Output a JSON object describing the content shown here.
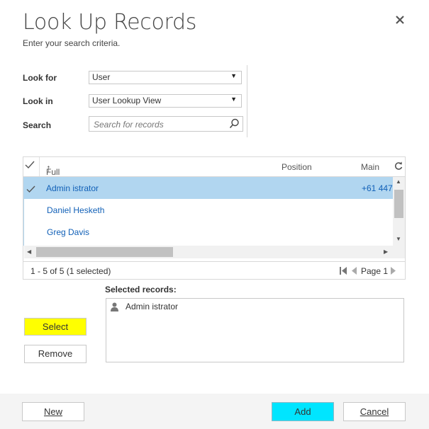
{
  "dialog": {
    "title": "Look Up Records",
    "subtitle": "Enter your search criteria.",
    "close_icon": "close-icon"
  },
  "form": {
    "look_for_label": "Look for",
    "look_for_value": "User",
    "look_in_label": "Look in",
    "look_in_value": "User Lookup View",
    "search_label": "Search",
    "search_placeholder": "Search for records"
  },
  "grid": {
    "columns": [
      "Full Name",
      "Position",
      "Main"
    ],
    "sort_indicator": "↑",
    "rows": [
      {
        "name": "Admin istrator",
        "phone": "+61 447",
        "selected": true
      },
      {
        "name": "Daniel Hesketh",
        "phone": "",
        "selected": false
      },
      {
        "name": "Greg Davis",
        "phone": "",
        "selected": false
      }
    ],
    "status": "1 - 5 of 5 (1 selected)",
    "page_label": "Page 1"
  },
  "selection": {
    "selected_records_label": "Selected records:",
    "selected_items": [
      "Admin istrator"
    ],
    "select_button": "Select",
    "remove_button": "Remove"
  },
  "footer": {
    "new_button": "New",
    "add_button": "Add",
    "cancel_button": "Cancel"
  },
  "colors": {
    "select_button_bg": "#ffff00",
    "add_button_bg": "#00e5ff",
    "selected_row_bg": "#b1d6f0",
    "link_color": "#1160b7"
  }
}
